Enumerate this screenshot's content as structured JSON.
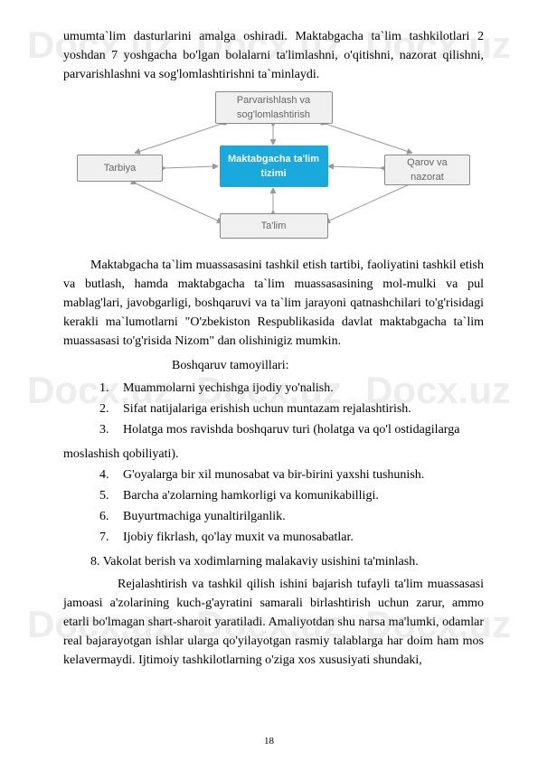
{
  "watermark": "Docx.uz",
  "paragraphs": {
    "p1": "umumta`lim dasturlarini amalga oshiradi. Maktabgacha ta`lim tashkilotlari 2 yoshdan 7 yoshgacha bo'lgan bolalarni ta'limlashni, o'qitishni, nazorat qilishni, parvarishlashni va sog'lomlashtirishni ta`minlaydi.",
    "p2": "Maktabgacha ta`lim muassasasini tashkil etish tartibi, faoliyatini tashkil etish va butlash, hamda maktabgacha ta`lim muassasasining mol-mulki va pul mablag'lari, javobgarligi, boshqaruvi va ta`lim jarayoni qatnashchilari to'g'risidagi kerakli ma`lumotlarni \"O'zbekiston Respublikasida davlat maktabgacha ta`lim muassasasi to'g'risida Nizom\" dan olishinigiz mumkin.",
    "section_title": "Boshqaruv tamoyillari:",
    "items": [
      "Muammolarni yechishga ijodiy yo'nalish.",
      "Sifat natijalariga erishish uchun muntazam rejalashtirish.",
      "Holatga mos ravishda boshqaruv turi (holatga va qo'l ostidagilarga",
      "G'oyalarga bir xil munosabat va bir-birini yaxshi tushunish.",
      "Barcha a'zolarning hamkorligi va komunikabilligi.",
      "Buyurtmachiga yunaltirilganlik.",
      "Ijobiy fikrlash, qo'lay muxit va munosabatlar."
    ],
    "item3_cont": "moslashish qobiliyati).",
    "item8": "8. Vakolat berish va xodimlarning malakaviy usishini ta'minlash.",
    "p3": "Rejalashtirish va tashkil qilish ishini bajarish tufayli ta'lim muassasasi jamoasi a'zolarining kuch-g'ayratini samarali birlashtirish uchun zarur, ammo etarli bo'lmagan shart-sharoit yaratiladi. Amaliyotdan shu narsa ma'lumki, odamlar real bajarayotgan ishlar ularga qo'yilayotgan rasmiy talablarga har doim ham mos kelavermaydi. Ijtimoiy tashkilotlarning o'ziga xos xususiyati shundaki,"
  },
  "diagram": {
    "top": "Parvarishlash va sog'lomlashtirish",
    "left": "Tarbiya",
    "center": "Maktabgacha ta'lim tizimi",
    "right": "Qarov va nazorat",
    "bottom": "Ta'lim"
  },
  "page_number": "18"
}
